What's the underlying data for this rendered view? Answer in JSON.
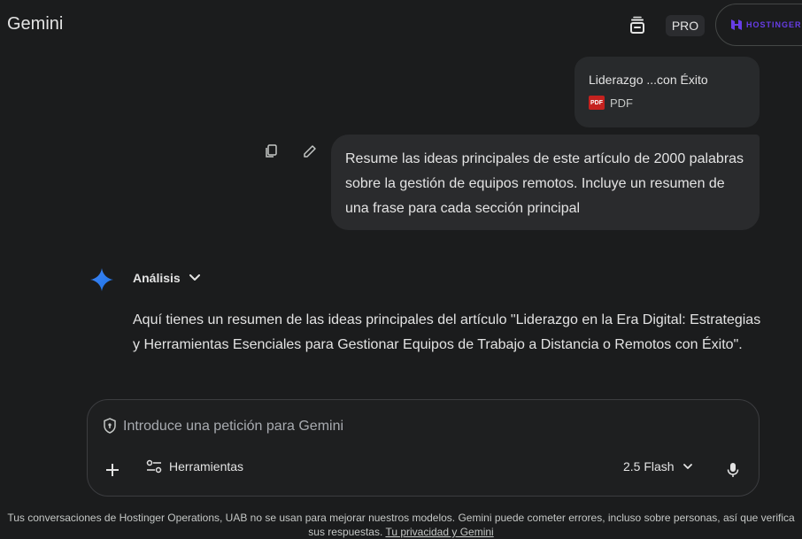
{
  "header": {
    "app_title": "Gemini",
    "plan_badge": "PRO",
    "account_brand": "HOSTINGER",
    "icons": {
      "history": "stacked-chat-icon",
      "brand": "hostinger-logo-icon"
    },
    "brand_color": "#673de6"
  },
  "conversation": {
    "attachment": {
      "name": "Liderazgo ...con Éxito",
      "type_label": "PDF",
      "badge_text": "PDF"
    },
    "user_message": "Resume las ideas principales de este artículo de 2000 palabras sobre la gestión de equipos remotos. Incluye un resumen de una frase para cada sección principal",
    "message_actions": {
      "copy_icon": "copy-icon",
      "edit_icon": "edit-pencil-icon"
    },
    "assistant": {
      "thinking_label": "Análisis",
      "response": "Aquí tienes un resumen de las ideas principales del artículo \"Liderazgo en la Era Digital: Estrategias y Herramientas Esenciales para Gestionar Equipos de Trabajo a Distancia o Remotos con Éxito\"."
    }
  },
  "composer": {
    "placeholder": "Introduce una petición para Gemini",
    "value": "",
    "tools_label": "Herramientas",
    "model_label": "2.5 Flash"
  },
  "footer": {
    "disclaimer": "Tus conversaciones de Hostinger Operations, UAB no se usan para mejorar nuestros modelos. Gemini puede cometer errores, incluso sobre personas, así que verifica sus respuestas.",
    "privacy_link": "Tu privacidad y Gemini"
  },
  "colors": {
    "background": "#1b1c1d",
    "bubble": "#2a2b2d",
    "gemini_spark_start": "#4285f4",
    "gemini_spark_end": "#1a73e8",
    "pdf_red": "#c5221f"
  }
}
